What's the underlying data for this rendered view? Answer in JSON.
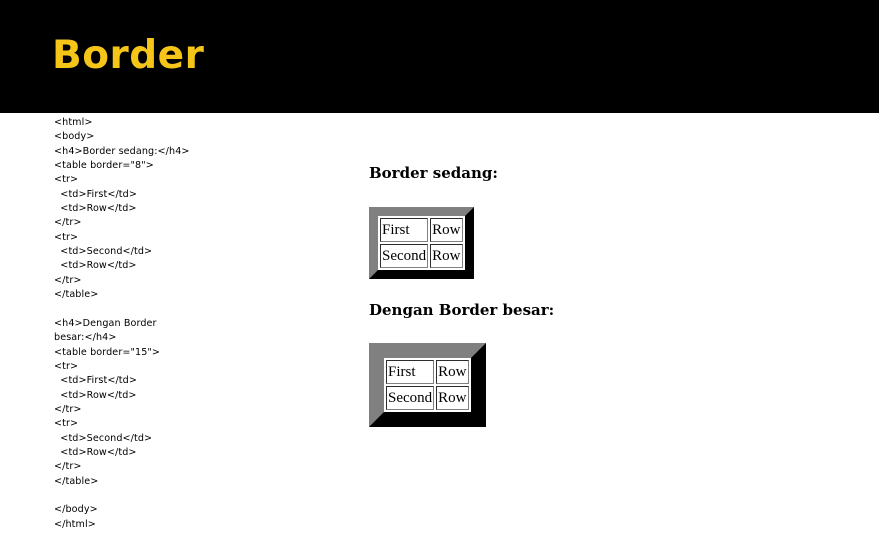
{
  "slide": {
    "title": "Border",
    "title_color": "#F5C518",
    "header_bg": "#000000"
  },
  "code_lines": [
    "<html>",
    "<body>",
    "<h4>Border sedang:</h4>",
    "<table border=\"8\">",
    "<tr>",
    "  <td>First</td>",
    "  <td>Row</td>",
    "</tr>",
    "<tr>",
    "  <td>Second</td>",
    "  <td>Row</td>",
    "</tr>",
    "</table>",
    "",
    "<h4>Dengan Border",
    "besar:</h4>",
    "<table border=\"15\">",
    "<tr>",
    "  <td>First</td>",
    "  <td>Row</td>",
    "</tr>",
    "<tr>",
    "  <td>Second</td>",
    "  <td>Row</td>",
    "</tr>",
    "</table>",
    "",
    "</body>",
    "</html>"
  ],
  "preview": {
    "sedang": {
      "heading": "Border sedang:",
      "border": 8,
      "rows": [
        [
          "First",
          "Row"
        ],
        [
          "Second",
          "Row"
        ]
      ]
    },
    "besar": {
      "heading": "Dengan Border besar:",
      "border": 15,
      "rows": [
        [
          "First",
          "Row"
        ],
        [
          "Second",
          "Row"
        ]
      ]
    }
  },
  "colors": {
    "border_light": "#808080",
    "border_dark": "#2c2c2c"
  }
}
